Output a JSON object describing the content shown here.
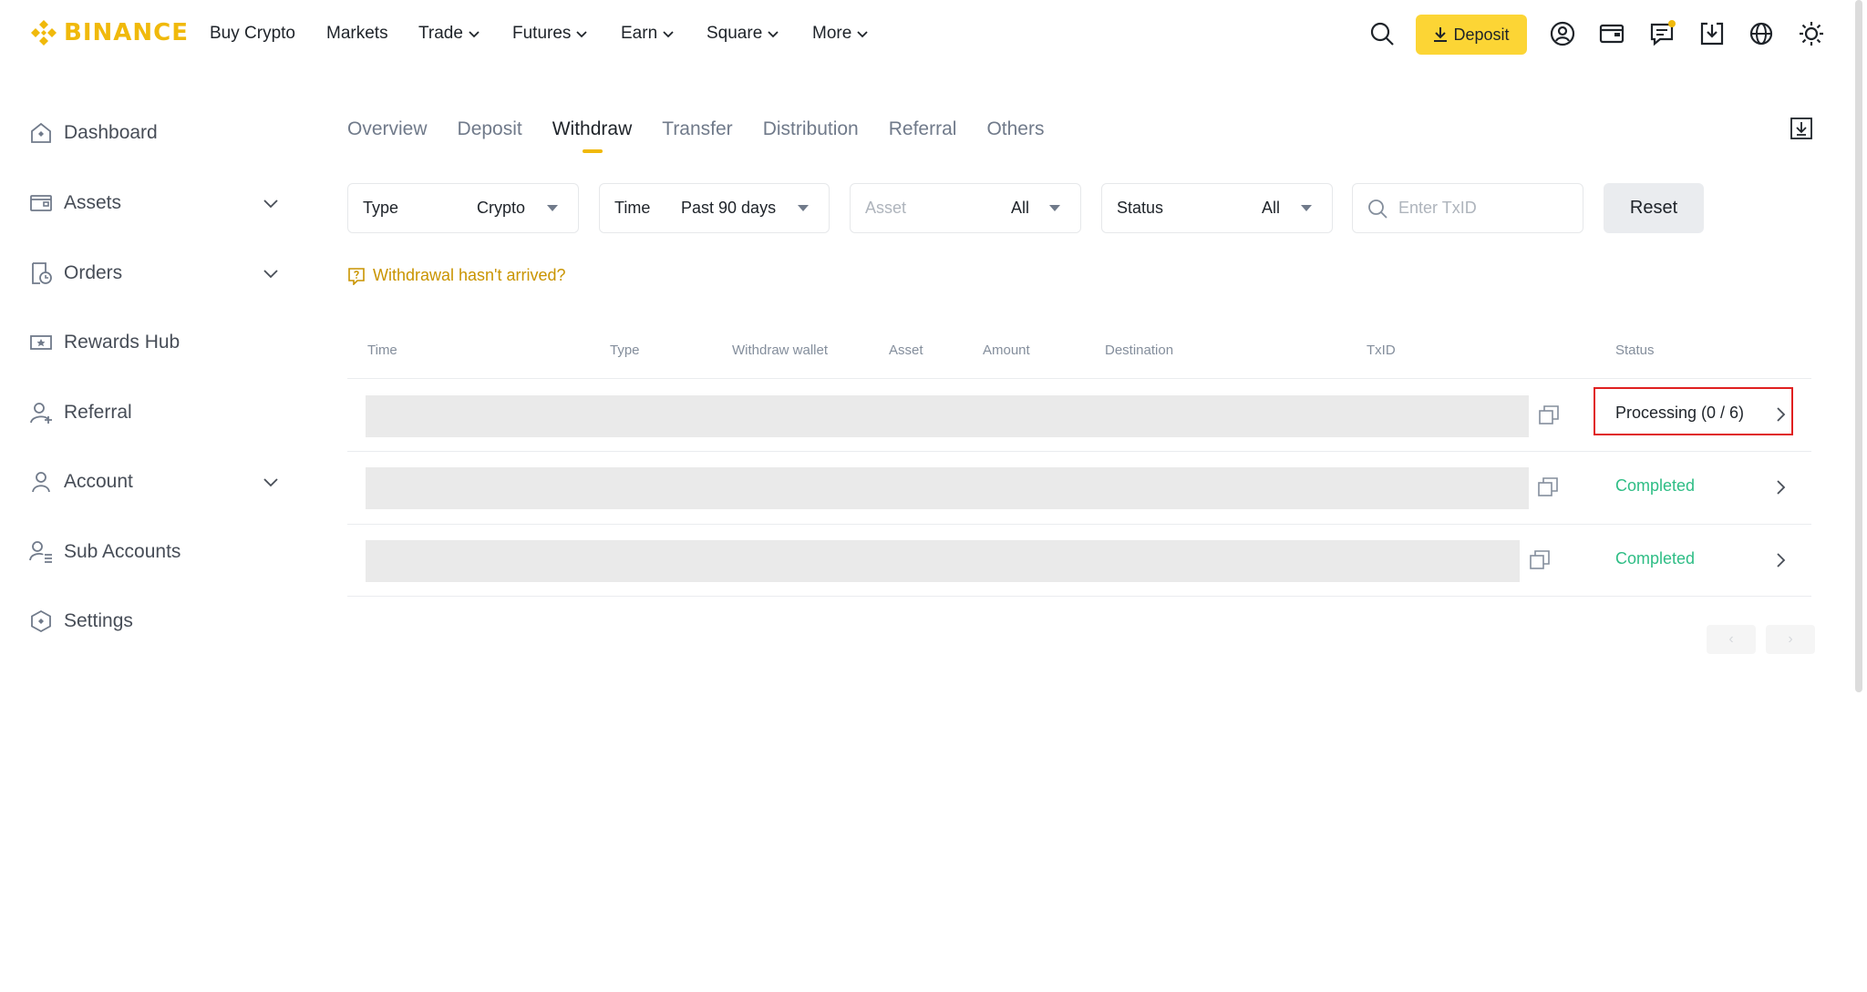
{
  "brand": {
    "name": "BINANCE",
    "color": "#f0b90b"
  },
  "topnav": {
    "items": [
      {
        "label": "Buy Crypto",
        "dropdown": false
      },
      {
        "label": "Markets",
        "dropdown": false
      },
      {
        "label": "Trade",
        "dropdown": true
      },
      {
        "label": "Futures",
        "dropdown": true
      },
      {
        "label": "Earn",
        "dropdown": true
      },
      {
        "label": "Square",
        "dropdown": true
      },
      {
        "label": "More",
        "dropdown": true
      }
    ],
    "deposit_label": "Deposit",
    "icons": [
      "search-icon",
      "user-icon",
      "wallet-icon",
      "messages-icon",
      "download-app-icon",
      "language-icon",
      "theme-icon"
    ]
  },
  "sidebar": {
    "items": [
      {
        "label": "Dashboard",
        "icon": "home-icon",
        "expandable": false
      },
      {
        "label": "Assets",
        "icon": "wallet-icon",
        "expandable": true
      },
      {
        "label": "Orders",
        "icon": "orders-icon",
        "expandable": true
      },
      {
        "label": "Rewards Hub",
        "icon": "ticket-icon",
        "expandable": false
      },
      {
        "label": "Referral",
        "icon": "add-user-icon",
        "expandable": false
      },
      {
        "label": "Account",
        "icon": "person-icon",
        "expandable": true
      },
      {
        "label": "Sub Accounts",
        "icon": "sub-accounts-icon",
        "expandable": false
      },
      {
        "label": "Settings",
        "icon": "settings-icon",
        "expandable": false
      }
    ]
  },
  "tabs": {
    "items": [
      "Overview",
      "Deposit",
      "Withdraw",
      "Transfer",
      "Distribution",
      "Referral",
      "Others"
    ],
    "active": "Withdraw"
  },
  "filters": {
    "type": {
      "label": "Type",
      "value": "Crypto"
    },
    "time": {
      "label": "Time",
      "value": "Past 90 days"
    },
    "asset": {
      "label": "Asset",
      "value": "All"
    },
    "status": {
      "label": "Status",
      "value": "All"
    },
    "txid": {
      "placeholder": "Enter TxID"
    },
    "reset_label": "Reset"
  },
  "help_link": "Withdrawal hasn't arrived?",
  "table": {
    "columns": [
      "Time",
      "Type",
      "Withdraw wallet",
      "Asset",
      "Amount",
      "Destination",
      "TxID",
      "Status"
    ],
    "rows": [
      {
        "status": "Processing (0 / 6)",
        "status_kind": "processing",
        "highlighted": true
      },
      {
        "status": "Completed",
        "status_kind": "completed",
        "highlighted": false
      },
      {
        "status": "Completed",
        "status_kind": "completed",
        "highlighted": false
      }
    ]
  },
  "colors": {
    "accent": "#fcd535",
    "success": "#2ebd85",
    "highlight": "#e02020"
  }
}
